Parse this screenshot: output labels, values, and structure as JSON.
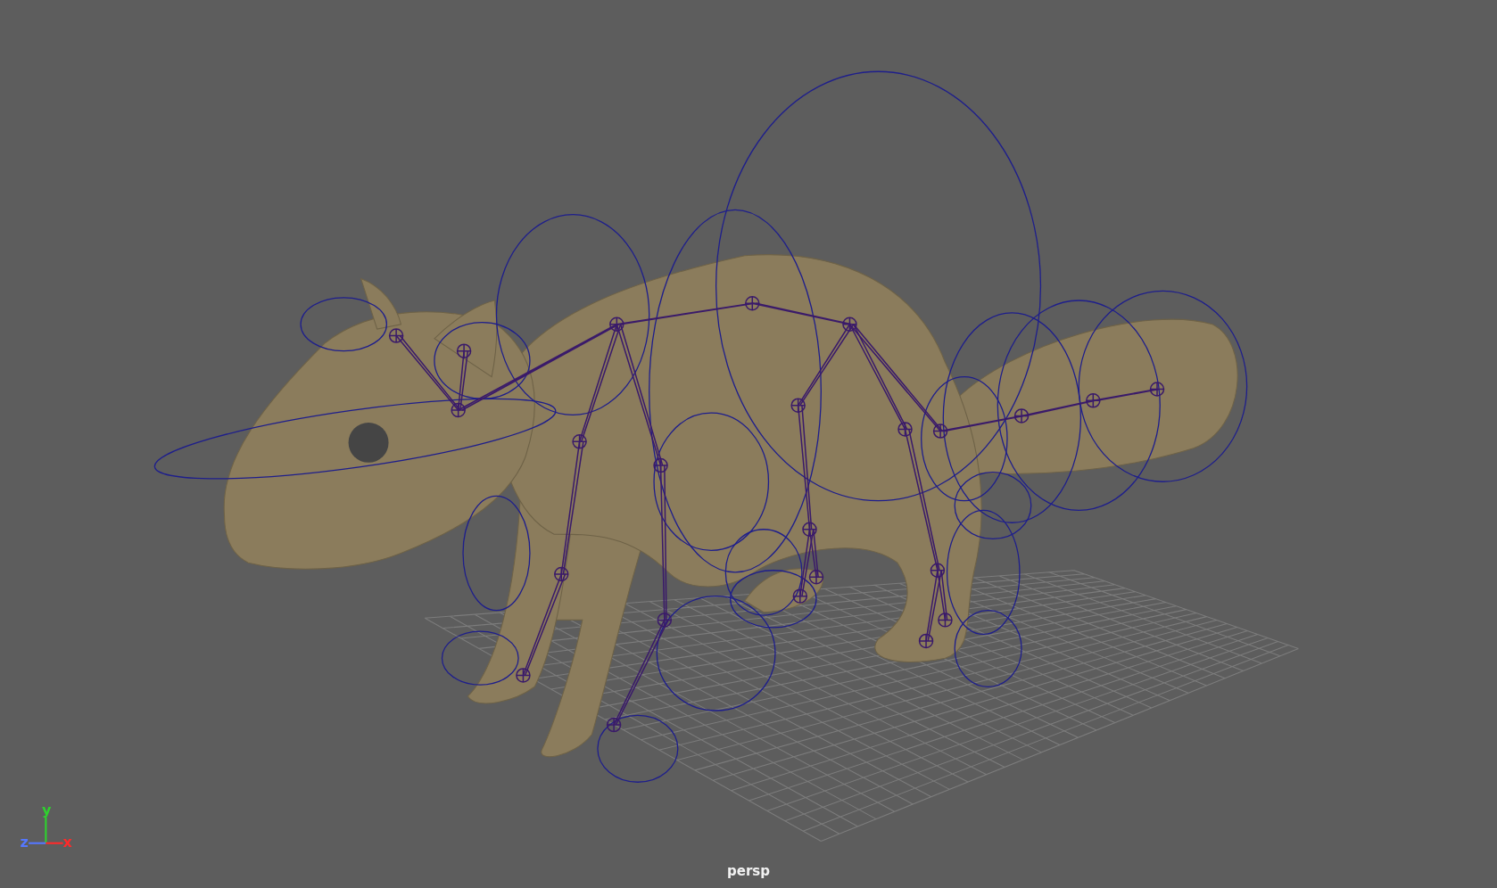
{
  "viewport": {
    "camera_label": "persp",
    "axes": [
      {
        "label": "y",
        "color": "#2fd12f"
      },
      {
        "label": "z",
        "color": "#5577ff"
      },
      {
        "label": "x",
        "color": "#ff2a2a"
      }
    ]
  }
}
